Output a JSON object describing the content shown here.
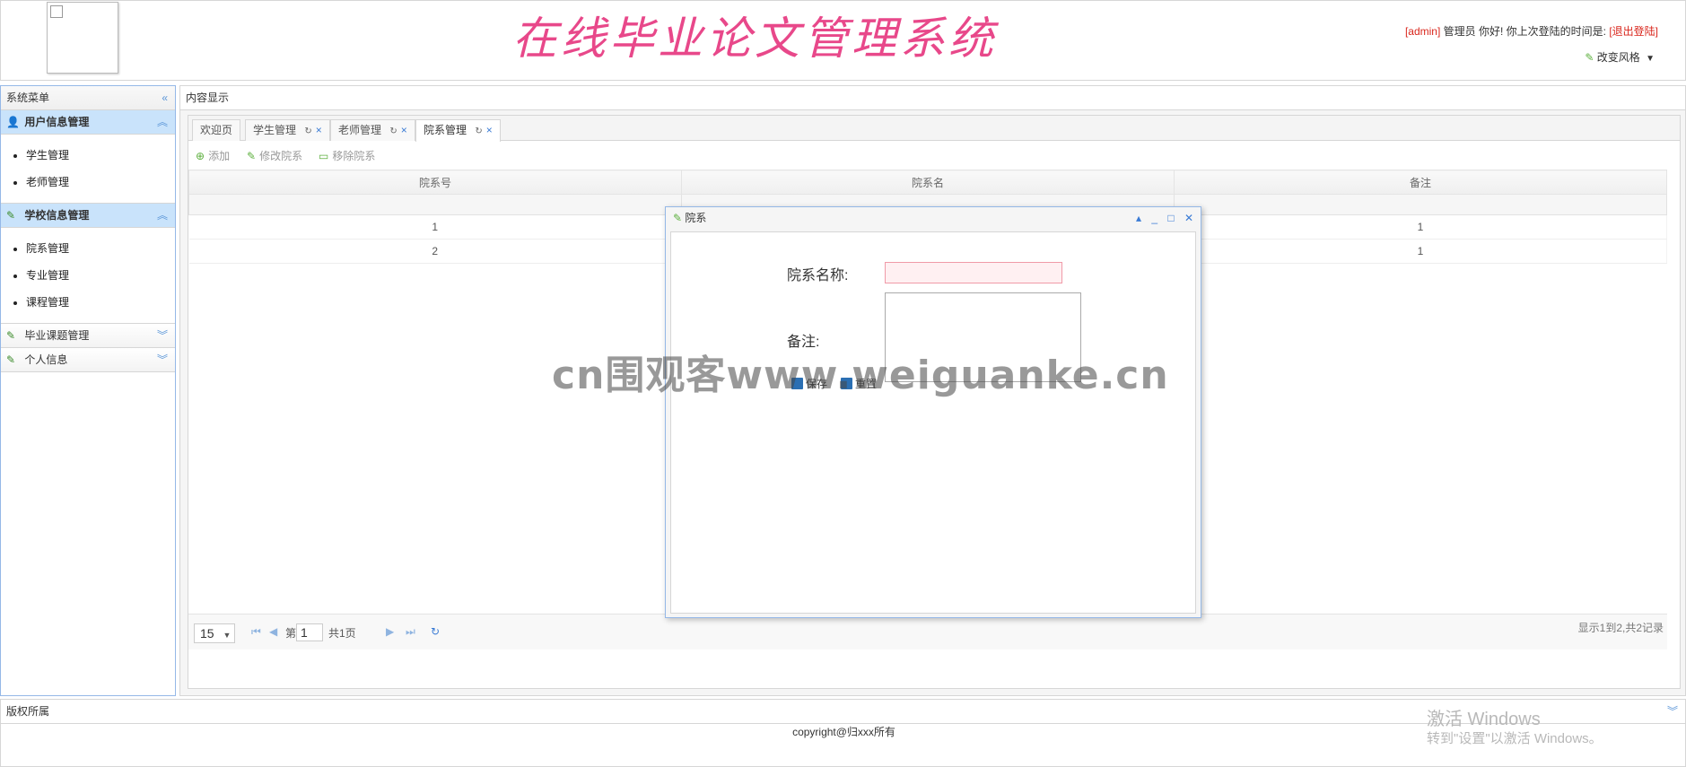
{
  "header": {
    "title": "在线毕业论文管理系统",
    "user": "[admin]",
    "greeting": "管理员 你好! 你上次登陆的时间是:",
    "logout": "[退出登陆]",
    "change_style": "改变风格"
  },
  "sidebar": {
    "title": "系统菜单",
    "groups": [
      {
        "label": "用户信息管理",
        "items": [
          "学生管理",
          "老师管理"
        ]
      },
      {
        "label": "学校信息管理",
        "items": [
          "院系管理",
          "专业管理",
          "课程管理"
        ]
      },
      {
        "label": "毕业课题管理",
        "items": []
      },
      {
        "label": "个人信息",
        "items": []
      }
    ]
  },
  "content": {
    "title": "内容显示",
    "tabs": [
      {
        "label": "欢迎页"
      },
      {
        "label": "学生管理"
      },
      {
        "label": "老师管理"
      },
      {
        "label": "院系管理"
      }
    ],
    "toolbar": {
      "add": "添加",
      "edit": "修改院系",
      "remove": "移除院系"
    },
    "grid": {
      "columns": [
        "院系号",
        "院系名",
        "备注"
      ],
      "rows": [
        [
          "1",
          "",
          "1"
        ],
        [
          "2",
          "",
          "1"
        ]
      ]
    },
    "pager": {
      "page_size": "15",
      "page_prefix": "第",
      "page_value": "1",
      "page_total": "共1页",
      "info": "显示1到2,共2记录"
    }
  },
  "dialog": {
    "title": "院系",
    "name_label": "院系名称:",
    "remark_label": "备注:",
    "save": "保存",
    "reset": "重置"
  },
  "watermark": "cn围观客www.weiguanke.cn",
  "footer": {
    "title": "版权所属",
    "copyright": "copyright@归xxx所有"
  },
  "os_overlay": {
    "line1": "激活 Windows",
    "line2": "转到\"设置\"以激活 Windows。"
  },
  "colors": {
    "accent": "#95b8e7",
    "title_pink": "#e8488a",
    "active_header": "#c9e3fb"
  }
}
